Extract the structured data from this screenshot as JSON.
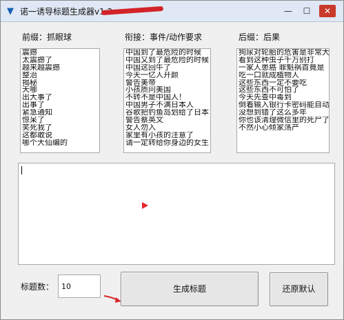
{
  "window": {
    "title": "诺一诱导标题生成器v1.2",
    "minimize_glyph": "—",
    "maximize_glyph": "☐",
    "close_glyph": "✕",
    "accent_color": "#1a5fb4"
  },
  "prefix": {
    "label": "前缀：抓眼球",
    "items": [
      "震撼",
      "太震撼了",
      "越来越震撼",
      "整治",
      "揭秘",
      "天哪",
      "出大事了",
      "出事了",
      "紧急通知",
      "惊呆了",
      "笑死我了",
      "这都敢说",
      "哪个大仙编的"
    ]
  },
  "middle": {
    "label": "衔接：事件/动作要求",
    "items": [
      "中国到了最危险的时候",
      "中国又到了最危险的时候",
      "中国这回牛了",
      "今天一亿人开颜",
      "警告美帝",
      "小孩质问美国",
      "不转不是中国人！",
      "中国男子不满日本人",
      "谷歌把钓鱼岛划给了日本",
      "警告蔡英文",
      "女人勿入",
      "家里有小孩的注意了",
      "请一定转给你身边的女生"
    ]
  },
  "suffix": {
    "label": "后缀：后果",
    "items": [
      "狗尿对轮胎的危害是非常大的",
      "看到这种虫子千万别打",
      "一家人患癌 罪魁祸首竟是",
      "吃一口就成植物人",
      "这些东西一定不要吃",
      "这些东西不可怕了",
      "今天先查中毒到",
      "倒着输入银行卡密码能自动报警",
      "没想到错了这么多年",
      "你也该清理微信里的死尸了",
      "不然小心倾家荡产"
    ]
  },
  "output": {
    "text": ""
  },
  "count": {
    "label": "标题数：",
    "value": "10"
  },
  "buttons": {
    "generate": "生成标题",
    "reset": "还原默认"
  }
}
